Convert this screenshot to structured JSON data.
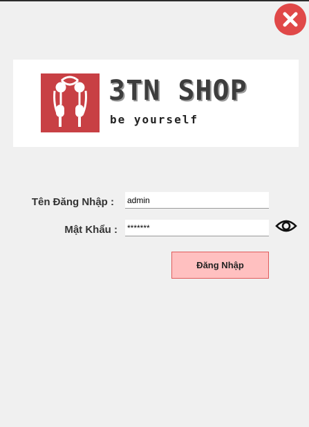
{
  "window": {
    "close_icon": "close-icon",
    "close_color": "#e04848"
  },
  "banner": {
    "brand_name": "3TN SHOP",
    "slogan": "be yourself",
    "logo_icon": "earphones-logo-icon",
    "logo_color": "#c84044"
  },
  "form": {
    "username_label": "Tên Đăng Nhập :",
    "username_value": "admin",
    "password_label": "Mật Khẩu :",
    "password_value": "*******",
    "show_password_icon": "eye-icon",
    "login_button_label": "Đăng Nhập",
    "login_button_bg": "#ffc0c0",
    "login_button_border": "#e05a5a"
  }
}
